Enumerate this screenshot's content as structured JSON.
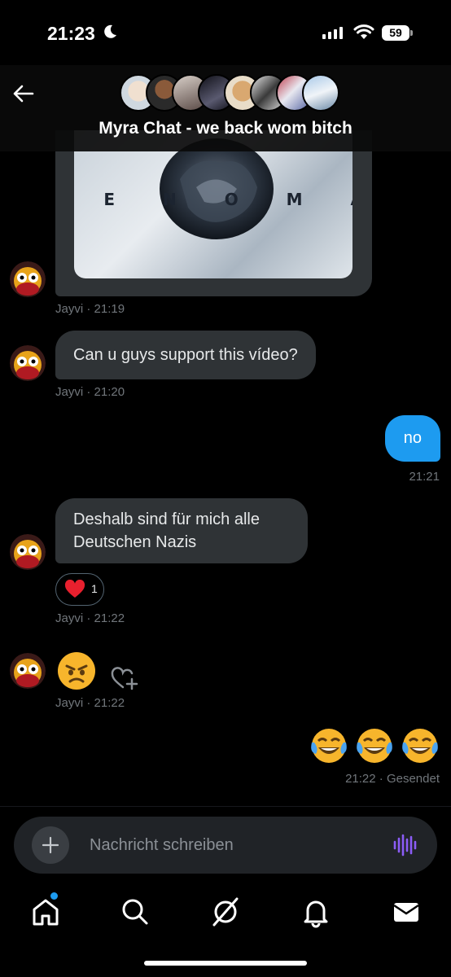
{
  "status_bar": {
    "time": "21:23",
    "battery": "59"
  },
  "header": {
    "title": "Myra Chat - we back wom bitch",
    "avatar_count": 8
  },
  "messages": [
    {
      "type": "media",
      "sender": "Jayvi",
      "image_text": "G E N O M A",
      "meta": "Jayvi · 21:19"
    },
    {
      "type": "text",
      "sender": "Jayvi",
      "text": "Can u guys support this vídeo?",
      "meta": "Jayvi · 21:20"
    },
    {
      "type": "outgoing",
      "text": "no",
      "meta": "21:21"
    },
    {
      "type": "text",
      "sender": "Jayvi",
      "text_line1": "Deshalb sind für mich alle",
      "text_line2": "Deutschen Nazis",
      "meta": "Jayvi · 21:22",
      "reaction": {
        "emoji": "heart",
        "count": "1"
      }
    },
    {
      "type": "emoji",
      "sender": "Jayvi",
      "emoji": "angry-face",
      "meta": "Jayvi · 21:22"
    },
    {
      "type": "outgoing-emoji",
      "emoji": [
        "laughing-tears",
        "laughing-tears",
        "laughing-tears"
      ],
      "meta": "21:22 · Gesendet"
    }
  ],
  "composer": {
    "placeholder": "Nachricht schreiben"
  },
  "tabbar": {
    "items": [
      "home",
      "search",
      "grok",
      "notifications",
      "messages"
    ]
  },
  "colors": {
    "accent": "#1d9bf0",
    "bubble_in": "#2f3336",
    "voice": "#8b5cf6"
  }
}
